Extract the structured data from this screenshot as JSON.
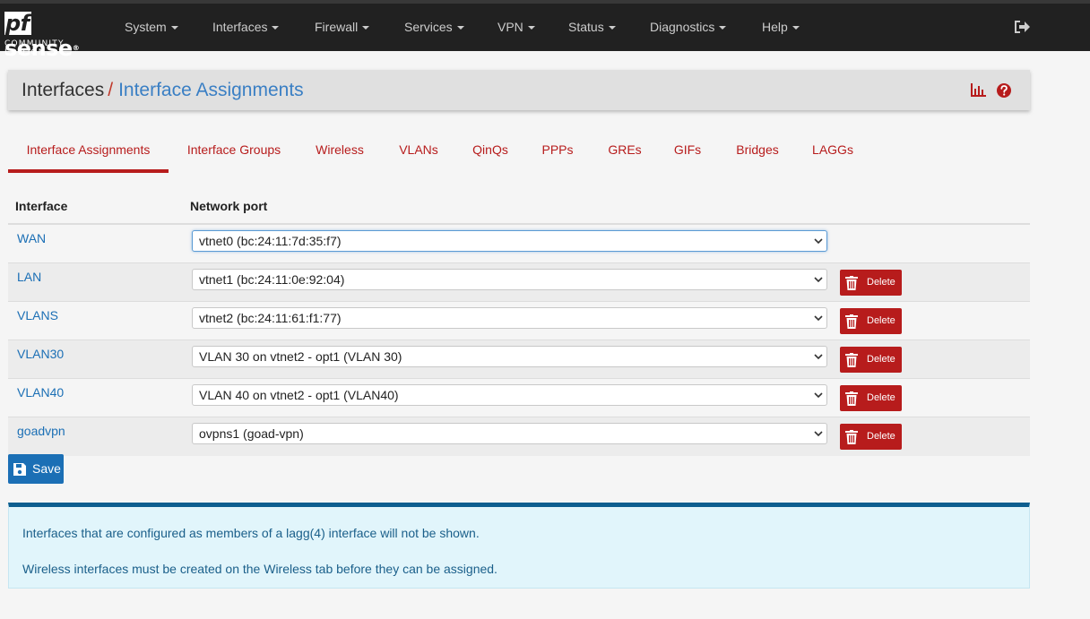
{
  "brand": {
    "name_pf": "pf",
    "name_sense": "sense",
    "reg": "®",
    "edition": "COMMUNITY EDITION"
  },
  "nav": {
    "items": [
      {
        "label": "System"
      },
      {
        "label": "Interfaces"
      },
      {
        "label": "Firewall"
      },
      {
        "label": "Services"
      },
      {
        "label": "VPN"
      },
      {
        "label": "Status"
      },
      {
        "label": "Diagnostics"
      },
      {
        "label": "Help"
      }
    ],
    "logout_icon": "sign-out-icon"
  },
  "breadcrumb": {
    "root": "Interfaces",
    "separator": "/",
    "current": "Interface Assignments"
  },
  "tabs": [
    {
      "label": "Interface Assignments",
      "active": true
    },
    {
      "label": "Interface Groups"
    },
    {
      "label": "Wireless"
    },
    {
      "label": "VLANs"
    },
    {
      "label": "QinQs"
    },
    {
      "label": "PPPs"
    },
    {
      "label": "GREs"
    },
    {
      "label": "GIFs"
    },
    {
      "label": "Bridges"
    },
    {
      "label": "LAGGs"
    }
  ],
  "table": {
    "headers": {
      "interface": "Interface",
      "network_port": "Network port"
    },
    "rows": [
      {
        "interface": "WAN",
        "port": "vtnet0 (bc:24:11:7d:35:f7)",
        "deletable": false
      },
      {
        "interface": "LAN",
        "port": "vtnet1 (bc:24:11:0e:92:04)",
        "deletable": true
      },
      {
        "interface": "VLANS",
        "port": "vtnet2 (bc:24:11:61:f1:77)",
        "deletable": true
      },
      {
        "interface": "VLAN30",
        "port": "VLAN 30 on vtnet2 - opt1 (VLAN 30)",
        "deletable": true
      },
      {
        "interface": "VLAN40",
        "port": "VLAN 40 on vtnet2 - opt1 (VLAN40)",
        "deletable": true
      },
      {
        "interface": "goadvpn",
        "port": "ovpns1 (goad-vpn)",
        "deletable": true
      }
    ],
    "delete_label": "Delete"
  },
  "save_label": "Save",
  "info": {
    "line1": "Interfaces that are configured as members of a lagg(4) interface will not be shown.",
    "line2": "Wireless interfaces must be created on the Wireless tab before they can be assigned."
  },
  "colors": {
    "accent_red": "#b71c1c",
    "link_blue": "#1b6fb5",
    "navbar": "#212121"
  }
}
